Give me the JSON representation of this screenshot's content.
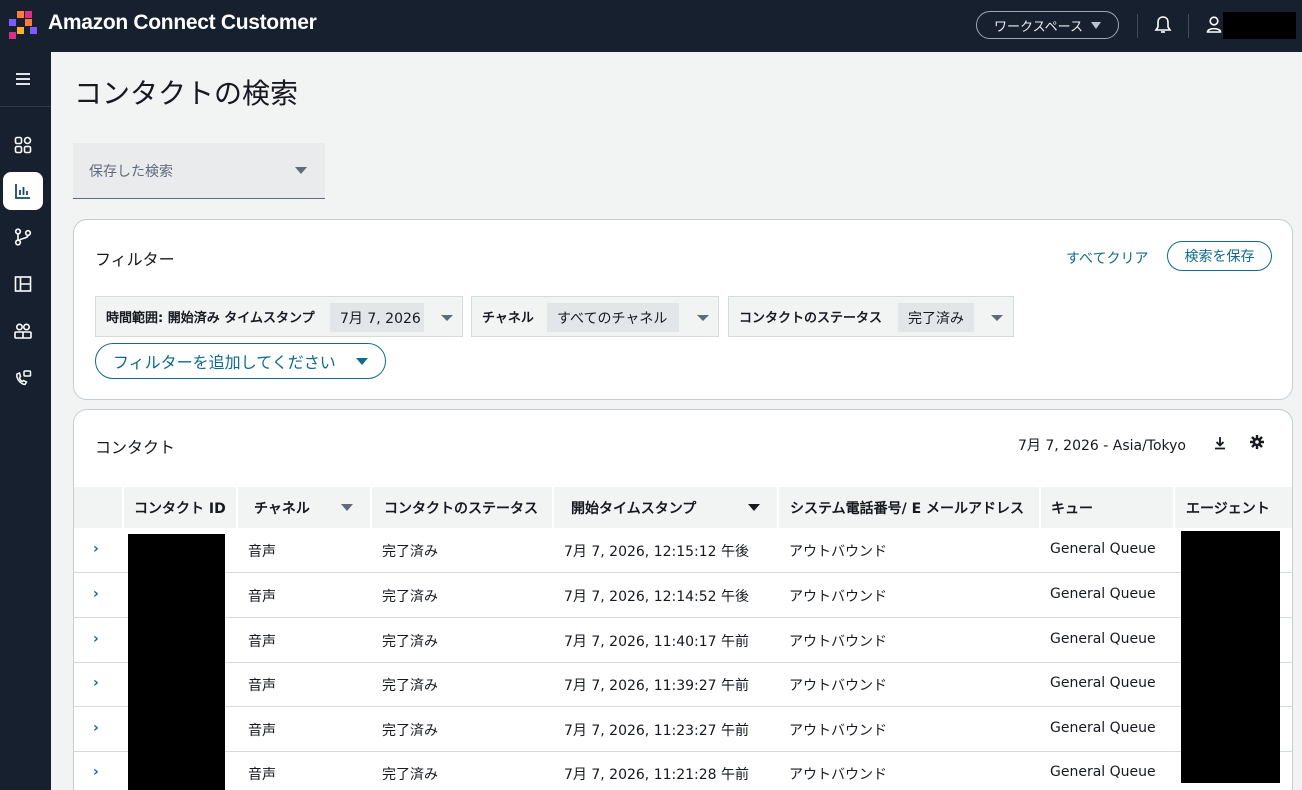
{
  "header": {
    "app_title": "Amazon Connect Customer",
    "workspace_label": "ワークスペース",
    "brand_colors": [
      "#ff7a3d",
      "#d63384",
      "#7b5cff",
      "#ffb02e"
    ]
  },
  "sidenav": {
    "items": [
      {
        "name": "menu-icon",
        "active": false
      },
      {
        "name": "dashboard-icon",
        "active": false
      },
      {
        "name": "analytics-icon",
        "active": true
      },
      {
        "name": "routing-icon",
        "active": false
      },
      {
        "name": "layout-icon",
        "active": false
      },
      {
        "name": "users-icon",
        "active": false
      },
      {
        "name": "channels-icon",
        "active": false
      }
    ]
  },
  "page": {
    "title": "コンタクトの検索",
    "saved_search_placeholder": "保存した検索"
  },
  "filters": {
    "title": "フィルター",
    "clear_all": "すべてクリア",
    "save_search": "検索を保存",
    "chips": [
      {
        "label": "時間範囲: 開始済み タイムスタンプ",
        "value": "7月 7, 2026"
      },
      {
        "label": "チャネル",
        "value": "すべてのチャネル"
      },
      {
        "label": "コンタクトのステータス",
        "value": "完了済み"
      }
    ],
    "add_filter": "フィルターを追加してください"
  },
  "contacts": {
    "title": "コンタクト",
    "date_range": "7月 7, 2026 - Asia/Tokyo",
    "columns": [
      "コンタクト ID",
      "チャネル",
      "コンタクトのステータス",
      "開始タイムスタンプ",
      "システム電話番号/ E メールアドレス",
      "キュー",
      "エージェント"
    ],
    "rows": [
      {
        "channel": "音声",
        "status": "完了済み",
        "start": "7月 7, 2026, 12:15:12 午後",
        "system": "アウトバウンド",
        "queue": "General Queue"
      },
      {
        "channel": "音声",
        "status": "完了済み",
        "start": "7月 7, 2026, 12:14:52 午後",
        "system": "アウトバウンド",
        "queue": "General Queue"
      },
      {
        "channel": "音声",
        "status": "完了済み",
        "start": "7月 7, 2026, 11:40:17 午前",
        "system": "アウトバウンド",
        "queue": "General Queue"
      },
      {
        "channel": "音声",
        "status": "完了済み",
        "start": "7月 7, 2026, 11:39:27 午前",
        "system": "アウトバウンド",
        "queue": "General Queue"
      },
      {
        "channel": "音声",
        "status": "完了済み",
        "start": "7月 7, 2026, 11:23:27 午前",
        "system": "アウトバウンド",
        "queue": "General Queue"
      },
      {
        "channel": "音声",
        "status": "完了済み",
        "start": "7月 7, 2026, 11:21:28 午前",
        "system": "アウトバウンド",
        "queue": "General Queue"
      }
    ]
  }
}
